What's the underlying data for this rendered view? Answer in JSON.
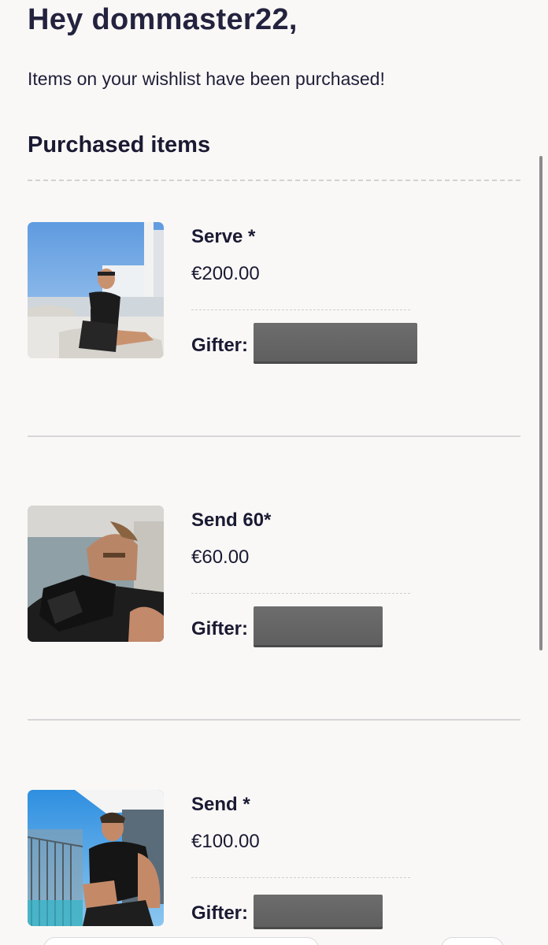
{
  "greeting": "Hey dommaster22,",
  "intro": "Items on your wishlist have been purchased!",
  "section_title": "Purchased items",
  "items": [
    {
      "name": "Serve *",
      "price": "€200.00",
      "gifter_label": "Gifter:",
      "gifter_value": ""
    },
    {
      "name": "Send 60*",
      "price": "€60.00",
      "gifter_label": "Gifter:",
      "gifter_value": ""
    },
    {
      "name": "Send *",
      "price": "€100.00",
      "gifter_label": "Gifter:",
      "gifter_value": ""
    }
  ],
  "colors": {
    "background": "#faf8f6",
    "text": "#1a1a33",
    "redaction": "#666666",
    "divider": "#d6d6d8"
  }
}
